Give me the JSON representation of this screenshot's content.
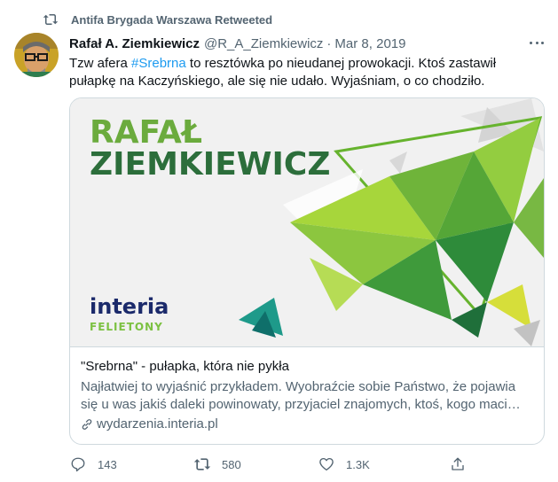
{
  "retweet": {
    "text": "Antifa Brygada Warszawa Retweeted",
    "icon": "retweet-icon"
  },
  "tweet": {
    "author_name": "Rafał A. Ziemkiewicz",
    "author_handle": "@R_A_Ziemkiewicz",
    "separator": "·",
    "date": "Mar 8, 2019",
    "text_before": "Tzw afera ",
    "hashtag": "#Srebrna",
    "text_after": " to resztówka po nieudanej prowokacji. Ktoś zastawił pułapkę na Kaczyńskiego, ale się nie udało. Wyjaśniam, o co chodziło."
  },
  "card": {
    "image": {
      "headline_line1": "RAFAŁ",
      "headline_line2": "ZIEMKIEWICZ",
      "brand": "interia",
      "brand_sub": "FELIETONY"
    },
    "title": "\"Srebrna\" - pułapka, która nie pykła",
    "description": "Najłatwiej to wyjaśnić przykładem. Wyobraźcie sobie Państwo, że pojawia się u was jakiś daleki powinowaty, przyjaciel znajomych, ktoś, kogo maci…",
    "domain": "wydarzenia.interia.pl"
  },
  "actions": {
    "reply_count": "143",
    "retweet_count": "580",
    "like_count": "1.3K"
  },
  "colors": {
    "accent": "#1d9bf0",
    "secondary_text": "#536471",
    "border": "#cfd9de",
    "brand_navy": "#1b2a6b",
    "brand_green": "#7cc142"
  }
}
